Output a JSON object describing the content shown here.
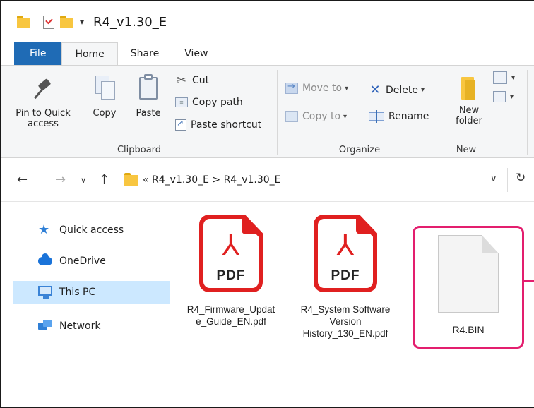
{
  "window": {
    "title": "R4_v1.30_E",
    "qat_dropdown": "▾"
  },
  "ribbon_tabs": [
    "File",
    "Home",
    "Share",
    "View"
  ],
  "ribbon": {
    "clipboard": {
      "label": "Clipboard",
      "pin": "Pin to Quick access",
      "copy": "Copy",
      "paste": "Paste",
      "cut": "Cut",
      "copy_path": "Copy path",
      "paste_shortcut": "Paste shortcut"
    },
    "organize": {
      "label": "Organize",
      "move_to": "Move to",
      "copy_to": "Copy to",
      "delete": "Delete",
      "rename": "Rename"
    },
    "new": {
      "label": "New",
      "new_folder": "New folder"
    }
  },
  "address": {
    "path": "« R4_v1.30_E > R4_v1.30_E"
  },
  "nav_pane": {
    "items": [
      {
        "label": "Quick access",
        "icon": "star-icon"
      },
      {
        "label": "OneDrive",
        "icon": "cloud-icon"
      },
      {
        "label": "This PC",
        "icon": "computer-icon",
        "selected": true
      },
      {
        "label": "Network",
        "icon": "network-icon"
      }
    ]
  },
  "files": [
    {
      "name": "R4_Firmware_Update_Guide_EN.pdf",
      "type": "pdf",
      "badge": "PDF"
    },
    {
      "name": "R4_System Software Version History_130_EN.pdf",
      "type": "pdf",
      "badge": "PDF"
    },
    {
      "name": "R4.BIN",
      "type": "bin",
      "highlighted": true
    }
  ],
  "colors": {
    "file_tab": "#1f6bb5",
    "selected_nav": "#cce8ff",
    "pdf_red": "#e02020",
    "highlight": "#e31e6e"
  }
}
